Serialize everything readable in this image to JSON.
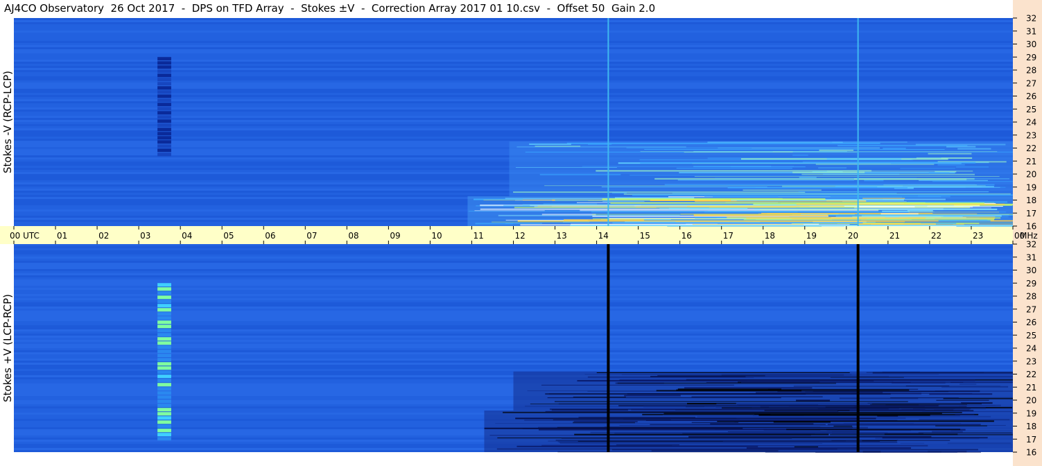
{
  "title": "AJ4CO Observatory  26 Oct 2017  -  DPS on TFD Array  -  Stokes ±V  -  Correction Array 2017 01 10.csv  -  Offset 50  Gain 2.0",
  "colors": {
    "background": "#ffffff",
    "time_axis_band": "#ffffc8",
    "freq_axis_band": "#fbe3cd",
    "spectrogram_base": "#1f5fe0",
    "marker_line_top": "#3fb8f0",
    "marker_line_bottom": "#000000"
  },
  "chart_data": {
    "type": "heatmap",
    "x_axis": {
      "unit": "UTC",
      "range": [
        0,
        24
      ],
      "ticks": [
        {
          "value": 0,
          "label": "00  UTC"
        },
        {
          "value": 1,
          "label": "01"
        },
        {
          "value": 2,
          "label": "02"
        },
        {
          "value": 3,
          "label": "03"
        },
        {
          "value": 4,
          "label": "04"
        },
        {
          "value": 5,
          "label": "05"
        },
        {
          "value": 6,
          "label": "06"
        },
        {
          "value": 7,
          "label": "07"
        },
        {
          "value": 8,
          "label": "08"
        },
        {
          "value": 9,
          "label": "09"
        },
        {
          "value": 10,
          "label": "10"
        },
        {
          "value": 11,
          "label": "11"
        },
        {
          "value": 12,
          "label": "12"
        },
        {
          "value": 13,
          "label": "13"
        },
        {
          "value": 14,
          "label": "14"
        },
        {
          "value": 15,
          "label": "15"
        },
        {
          "value": 16,
          "label": "16"
        },
        {
          "value": 17,
          "label": "17"
        },
        {
          "value": 18,
          "label": "18"
        },
        {
          "value": 19,
          "label": "19"
        },
        {
          "value": 20,
          "label": "20"
        },
        {
          "value": 21,
          "label": "21"
        },
        {
          "value": 22,
          "label": "22"
        },
        {
          "value": 23,
          "label": "23"
        },
        {
          "value": 24,
          "label": "00"
        }
      ]
    },
    "y_axis": {
      "unit": "MHz",
      "range": [
        16,
        32
      ],
      "ticks": [
        "16",
        "17",
        "18",
        "19",
        "20",
        "21",
        "22",
        "23",
        "24",
        "25",
        "26",
        "27",
        "28",
        "29",
        "30",
        "31",
        "32"
      ]
    },
    "panels": [
      {
        "label": "Stokes -V (RCP-LCP)",
        "marker_lines_utc": [
          14.28,
          20.28
        ],
        "vertical_bands": [
          {
            "start": 3.45,
            "end": 3.78,
            "freq_low": 21.5,
            "freq_high": 29.0,
            "tone": "dark"
          }
        ],
        "activity_regions": [
          {
            "utc_start": 10.9,
            "utc_end": 24.0,
            "freq_low": 16.0,
            "freq_high": 18.3,
            "intensity": "high"
          },
          {
            "utc_start": 11.9,
            "utc_end": 24.0,
            "freq_low": 18.3,
            "freq_high": 22.5,
            "intensity": "medium"
          }
        ]
      },
      {
        "label": "Stokes +V (LCP-RCP)",
        "marker_lines_utc": [
          14.28,
          20.28
        ],
        "vertical_bands": [
          {
            "start": 3.45,
            "end": 3.78,
            "freq_low": 17.0,
            "freq_high": 29.0,
            "tone": "bright"
          }
        ],
        "activity_regions": [
          {
            "utc_start": 11.3,
            "utc_end": 24.0,
            "freq_low": 16.0,
            "freq_high": 19.2,
            "intensity": "dark"
          },
          {
            "utc_start": 12.0,
            "utc_end": 24.0,
            "freq_low": 19.2,
            "freq_high": 22.2,
            "intensity": "dark"
          }
        ]
      }
    ]
  }
}
